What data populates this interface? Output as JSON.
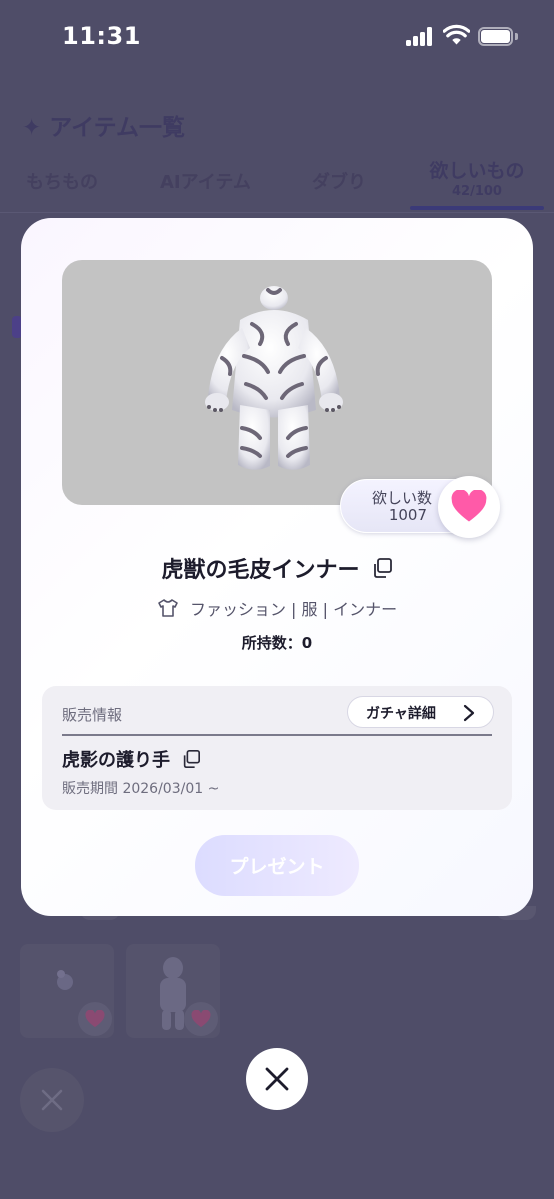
{
  "status_bar": {
    "time": "11:31"
  },
  "background_page": {
    "title": "✦ アイテム一覧",
    "tabs": [
      {
        "label": "もちもの"
      },
      {
        "label": "AIアイテム"
      },
      {
        "label": "ダブり"
      },
      {
        "label": "欲しいもの",
        "count": "42/100",
        "active": true
      }
    ]
  },
  "modal": {
    "want": {
      "label": "欲しい数",
      "count": "1007"
    },
    "item_name": "虎獣の毛皮インナー",
    "category": "ファッション | 服 | インナー",
    "owned": "所持数：0",
    "sale": {
      "header": "販売情報",
      "gacha_button": "ガチャ詳細",
      "gacha_name": "虎影の護り手",
      "period": "販売期間 2026/03/01 ~"
    },
    "present_button": "プレゼント"
  },
  "colors": {
    "overlay": "#4f4d68",
    "heart": "#ff5aa8",
    "accent": "#3b3a78",
    "present_button": "#dcdcff"
  },
  "icons": [
    "signal-icon",
    "wifi-icon",
    "battery-icon",
    "heart-icon",
    "copy-icon",
    "shirt-icon",
    "chevron-right-icon",
    "close-icon"
  ]
}
